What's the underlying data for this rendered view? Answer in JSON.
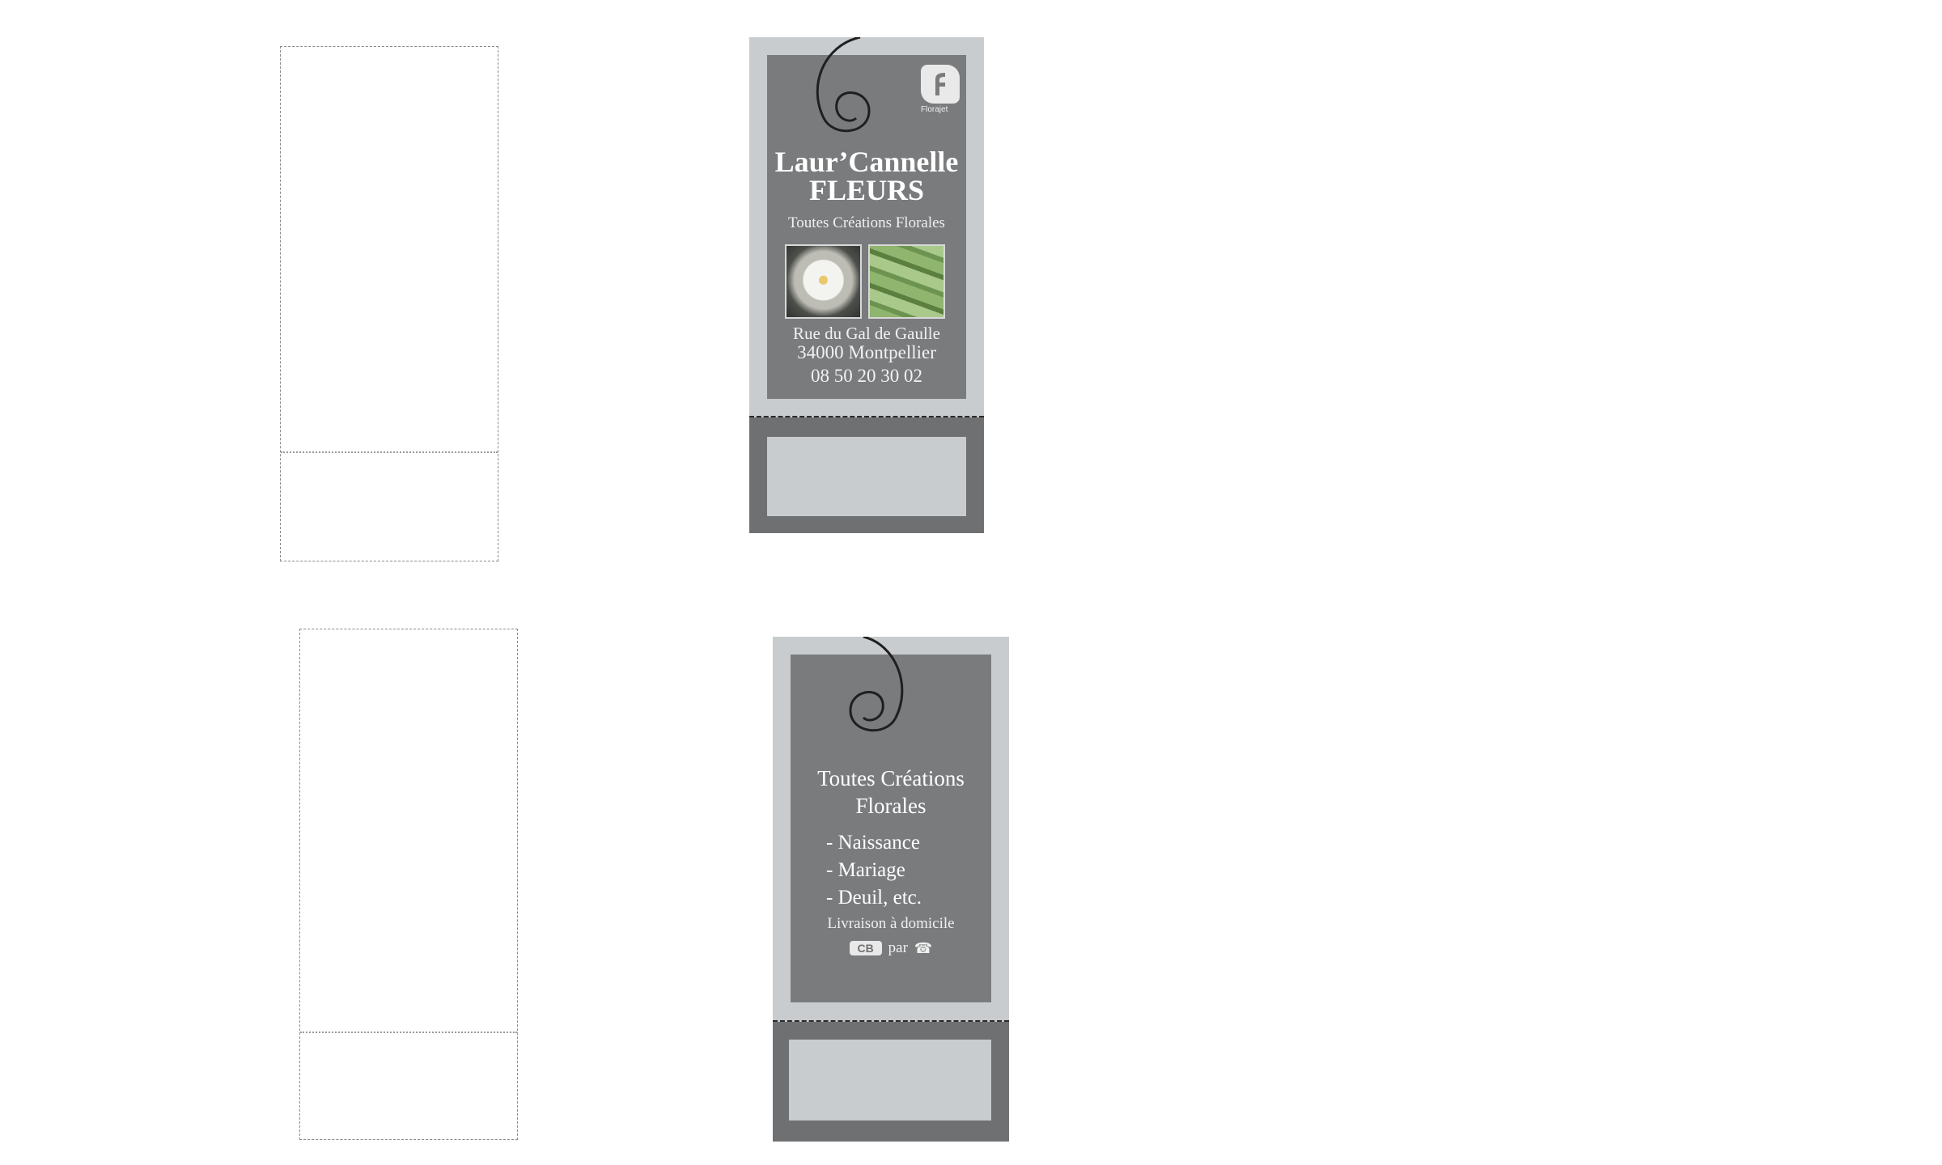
{
  "front": {
    "shop_name_line1": "Laur’Cannelle",
    "shop_name_line2": "FLEURS",
    "tagline": "Toutes Créations Florales",
    "address": "Rue du Gal de Gaulle",
    "city": "34000 Montpellier",
    "phone": "08 50 20 30 02",
    "logo_caption": "Florajet",
    "logo_icon": "florajet-logo-icon",
    "photos": [
      "white-flower-photo",
      "green-leaf-photo"
    ]
  },
  "back": {
    "heading_line1": "Toutes Créations",
    "heading_line2": "Florales",
    "services": [
      "- Naissance",
      "- Mariage",
      "- Deuil, etc."
    ],
    "delivery": "Livraison à domicile",
    "payment_card_label": "CB",
    "payment_connector": "par",
    "payment_phone_icon": "phone-icon"
  },
  "colors": {
    "panel_gray": "#7a7b7d",
    "border_light": "#c9ccce",
    "text": "#ffffff"
  }
}
